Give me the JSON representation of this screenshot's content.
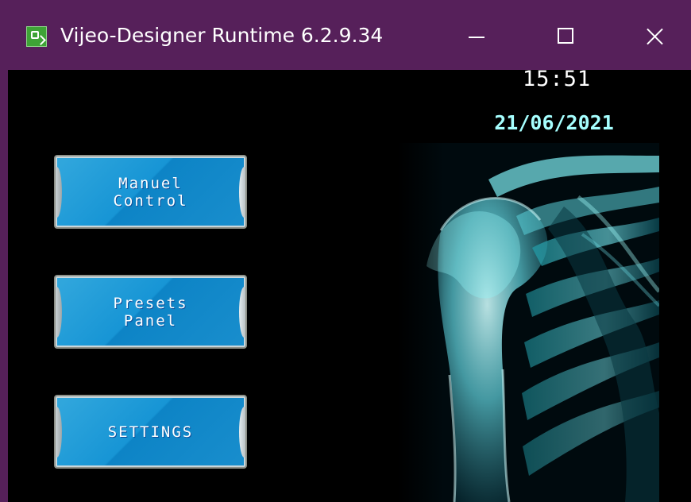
{
  "window": {
    "title": "Vijeo-Designer Runtime 6.2.9.34",
    "controls": {
      "minimize": "minimize-icon",
      "maximize": "maximize-icon",
      "close": "close-icon"
    },
    "titlebar_color": "#56205A"
  },
  "screen": {
    "time": "15:51",
    "date": "21/06/2021",
    "background_image": "shoulder-xray-image",
    "buttons": [
      {
        "label": "Manuel\nControl"
      },
      {
        "label": "Presets\nPanel"
      },
      {
        "label": "SETTINGS"
      }
    ],
    "colors": {
      "button_blue": "#1795D5",
      "date_text": "#A6FFFF",
      "background": "#000000"
    }
  }
}
